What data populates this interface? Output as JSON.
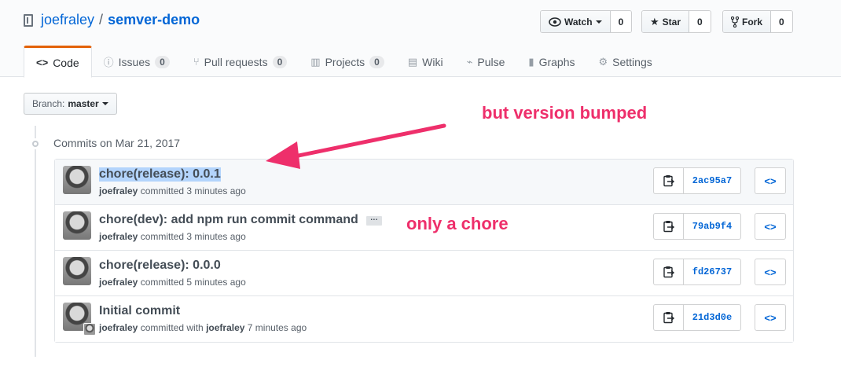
{
  "repo": {
    "owner": "joefraley",
    "separator": "/",
    "name": "semver-demo"
  },
  "actions": [
    {
      "label": "Watch",
      "icon": "eye-icon",
      "count": "0",
      "has_caret": true
    },
    {
      "label": "Star",
      "icon": "star-icon",
      "count": "0",
      "has_caret": false
    },
    {
      "label": "Fork",
      "icon": "fork-icon",
      "count": "0",
      "has_caret": false
    }
  ],
  "tabs": [
    {
      "label": "Code",
      "icon": "code-icon",
      "selected": true
    },
    {
      "label": "Issues",
      "icon": "issue-icon",
      "counter": "0"
    },
    {
      "label": "Pull requests",
      "icon": "pull-request-icon",
      "counter": "0"
    },
    {
      "label": "Projects",
      "icon": "project-icon",
      "counter": "0"
    },
    {
      "label": "Wiki",
      "icon": "book-icon"
    },
    {
      "label": "Pulse",
      "icon": "pulse-icon"
    },
    {
      "label": "Graphs",
      "icon": "graph-icon"
    },
    {
      "label": "Settings",
      "icon": "gear-icon"
    }
  ],
  "branch": {
    "label": "Branch:",
    "value": "master"
  },
  "commits_header": "Commits on Mar 21, 2017",
  "commits": [
    {
      "message": "chore(release): 0.0.1",
      "author": "joefraley",
      "action": "committed 3 minutes ago",
      "sha": "2ac95a7",
      "highlighted": true
    },
    {
      "message": "chore(dev): add npm run commit command",
      "author": "joefraley",
      "action": "committed 3 minutes ago",
      "sha": "79ab9f4",
      "ellipsis": "…"
    },
    {
      "message": "chore(release): 0.0.0",
      "author": "joefraley",
      "action": "committed 5 minutes ago",
      "sha": "fd26737"
    },
    {
      "message": "Initial commit",
      "author": "joefraley",
      "action": "committed with",
      "coauthor": "joefraley",
      "time": "7 minutes ago",
      "sha": "21d3d0e"
    }
  ],
  "annotations": {
    "note_top": "but version bumped",
    "note_middle": "only a chore",
    "color": "#ee2f6b"
  },
  "colors": {
    "link": "#0366d6",
    "tab_accent": "#e36209"
  }
}
